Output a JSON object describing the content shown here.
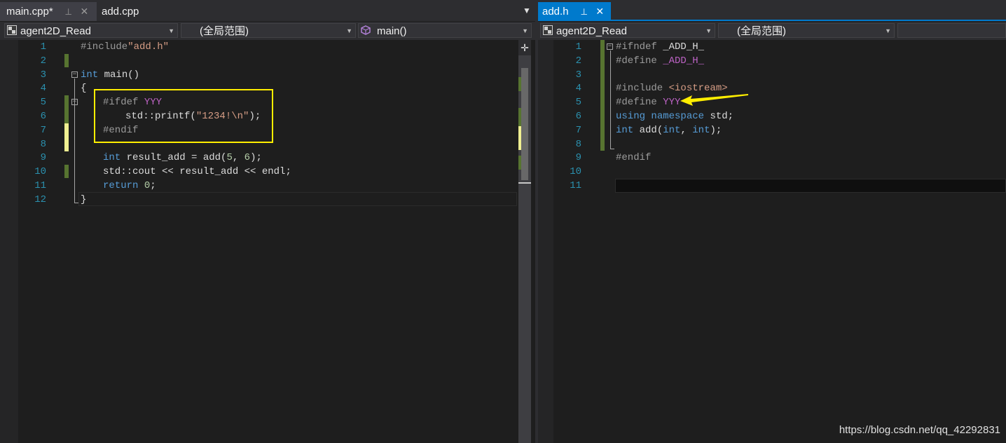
{
  "left": {
    "tabs": [
      {
        "label": "main.cpp*"
      },
      {
        "label": "add.cpp"
      }
    ],
    "tab_pin_icon": "⊣",
    "tab_close_icon": "✕",
    "tab_overflow_icon": "▼",
    "nav": {
      "project": "agent2D_Read",
      "scope": "(全局范围)",
      "member": "main()"
    },
    "line_numbers": [
      "1",
      "2",
      "3",
      "4",
      "5",
      "6",
      "7",
      "8",
      "9",
      "10",
      "11",
      "12"
    ]
  },
  "right": {
    "tab": {
      "label": "add.h"
    },
    "tab_pin_icon": "⊣",
    "tab_close_icon": "✕",
    "nav": {
      "project": "agent2D_Read",
      "scope": "(全局范围)"
    },
    "line_numbers": [
      "1",
      "2",
      "3",
      "4",
      "5",
      "6",
      "7",
      "8",
      "9",
      "10",
      "11"
    ]
  },
  "code": {
    "l1_pp": "#include",
    "l1_str": "\"add.h\"",
    "l3_kw": "int",
    "l3_rest": " main()",
    "l4": "{",
    "l5_pp": "#ifdef ",
    "l5_mac": "YYY",
    "l6_a": "std::printf(",
    "l6_str": "\"1234!\\n\"",
    "l6_b": ");",
    "l7_pp": "#endif",
    "l9_kw": "int",
    "l9_a": " result_add = add(",
    "l9_n1": "5",
    "l9_c": ", ",
    "l9_n2": "6",
    "l9_b": ");",
    "l10": "std::cout << result_add << endl;",
    "l11_kw": "return",
    "l11_sp": " ",
    "l11_num": "0",
    "l11_b": ";",
    "l12": "}"
  },
  "header_code": {
    "h1_pp": "#ifndef ",
    "h1_id": "_ADD_H_",
    "h2_pp": "#define ",
    "h2_mac": "_ADD_H_",
    "h4_pp": "#include ",
    "h4_str": "<iostream>",
    "h5_pp": "#define ",
    "h5_mac": "YYY",
    "h6_kw1": "using",
    "h6_sp": " ",
    "h6_kw2": "namespace",
    "h6_rest": " std;",
    "h7_kw": "int",
    "h7_a": " add(",
    "h7_kw2": "int",
    "h7_c": ", ",
    "h7_kw3": "int",
    "h7_b": ");",
    "h9_pp": "#endif"
  },
  "colors": {
    "highlight_box": "#ffee00",
    "arrow": "#ffee00",
    "active_tab": "#007acc"
  },
  "watermark": "https://blog.csdn.net/qq_42292831"
}
